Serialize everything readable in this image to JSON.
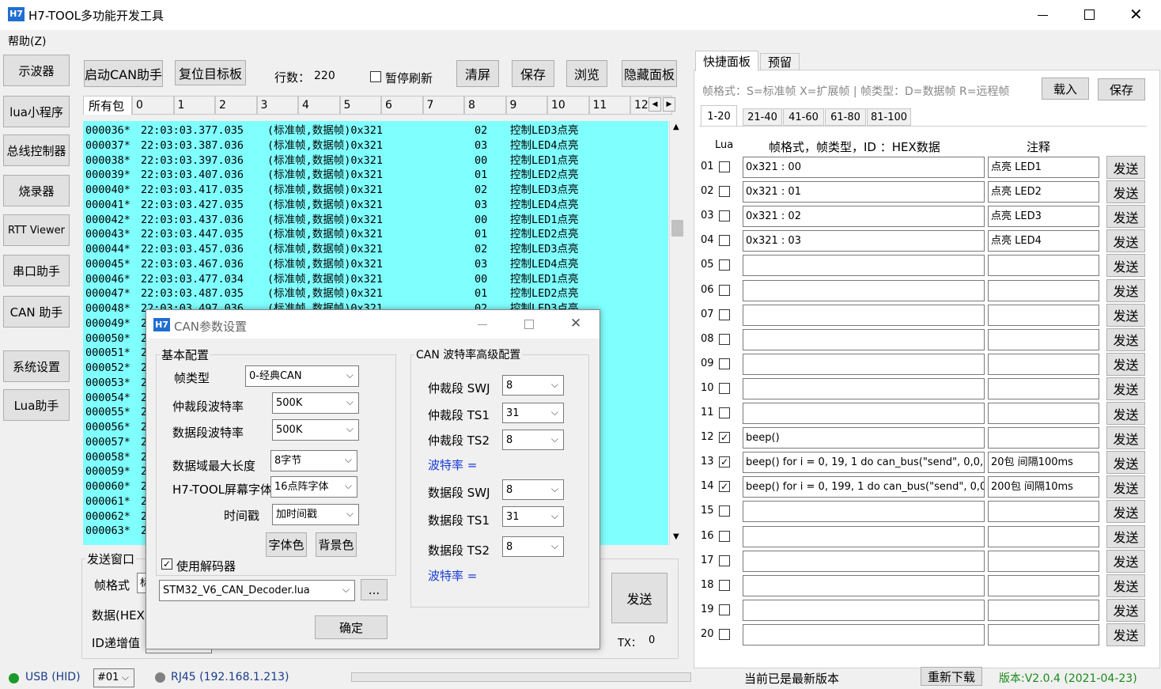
{
  "window": {
    "title": "H7-TOOL多功能开发工具",
    "logo": "H7",
    "min_icon": "minimize-icon",
    "max_icon": "maximize-icon",
    "close_icon": "close-icon"
  },
  "menu": {
    "help": "帮助(Z)"
  },
  "sidebar": {
    "items": [
      {
        "label": "示波器"
      },
      {
        "label": "lua小程序"
      },
      {
        "label": "总线控制器"
      },
      {
        "label": "烧录器"
      },
      {
        "label": "RTT Viewer"
      },
      {
        "label": "串口助手"
      },
      {
        "label": "CAN 助手"
      },
      {
        "label": "系统设置"
      },
      {
        "label": "Lua助手"
      }
    ]
  },
  "toolbar": {
    "start_can": "启动CAN助手",
    "reset_target": "复位目标板",
    "rows_label": "行数：",
    "rows_value": "220",
    "pause_refresh": "暂停刷新",
    "clear": "清屏",
    "save": "保存",
    "browse": "浏览",
    "hide_panel": "隐藏面板"
  },
  "packet_tabs": [
    "所有包",
    "0",
    "1",
    "2",
    "3",
    "4",
    "5",
    "6",
    "7",
    "8",
    "9",
    "10",
    "11",
    "12"
  ],
  "log": [
    {
      "idx": "000036*",
      "time": "22:03:03.377.035",
      "type": "(标准帧,数据帧)0x321",
      "data": "02",
      "note": "控制LED3点亮"
    },
    {
      "idx": "000037*",
      "time": "22:03:03.387.036",
      "type": "(标准帧,数据帧)0x321",
      "data": "03",
      "note": "控制LED4点亮"
    },
    {
      "idx": "000038*",
      "time": "22:03:03.397.036",
      "type": "(标准帧,数据帧)0x321",
      "data": "00",
      "note": "控制LED1点亮"
    },
    {
      "idx": "000039*",
      "time": "22:03:03.407.036",
      "type": "(标准帧,数据帧)0x321",
      "data": "01",
      "note": "控制LED2点亮"
    },
    {
      "idx": "000040*",
      "time": "22:03:03.417.035",
      "type": "(标准帧,数据帧)0x321",
      "data": "02",
      "note": "控制LED3点亮"
    },
    {
      "idx": "000041*",
      "time": "22:03:03.427.035",
      "type": "(标准帧,数据帧)0x321",
      "data": "03",
      "note": "控制LED4点亮"
    },
    {
      "idx": "000042*",
      "time": "22:03:03.437.036",
      "type": "(标准帧,数据帧)0x321",
      "data": "00",
      "note": "控制LED1点亮"
    },
    {
      "idx": "000043*",
      "time": "22:03:03.447.035",
      "type": "(标准帧,数据帧)0x321",
      "data": "01",
      "note": "控制LED2点亮"
    },
    {
      "idx": "000044*",
      "time": "22:03:03.457.036",
      "type": "(标准帧,数据帧)0x321",
      "data": "02",
      "note": "控制LED3点亮"
    },
    {
      "idx": "000045*",
      "time": "22:03:03.467.036",
      "type": "(标准帧,数据帧)0x321",
      "data": "03",
      "note": "控制LED4点亮"
    },
    {
      "idx": "000046*",
      "time": "22:03:03.477.034",
      "type": "(标准帧,数据帧)0x321",
      "data": "00",
      "note": "控制LED1点亮"
    },
    {
      "idx": "000047*",
      "time": "22:03:03.487.035",
      "type": "(标准帧,数据帧)0x321",
      "data": "01",
      "note": "控制LED2点亮"
    },
    {
      "idx": "000048*",
      "time": "22:03:03.497.036",
      "type": "(标准帧,数据帧)0x321",
      "data": "02",
      "note": "控制LED3点亮"
    },
    {
      "idx": "000049*",
      "time": "2",
      "type": "",
      "data": "",
      "note": ""
    },
    {
      "idx": "000050*",
      "time": "2",
      "type": "",
      "data": "",
      "note": ""
    },
    {
      "idx": "000051*",
      "time": "2",
      "type": "",
      "data": "",
      "note": ""
    },
    {
      "idx": "000052*",
      "time": "2",
      "type": "",
      "data": "",
      "note": ""
    },
    {
      "idx": "000053*",
      "time": "2",
      "type": "",
      "data": "",
      "note": ""
    },
    {
      "idx": "000054*",
      "time": "2",
      "type": "",
      "data": "",
      "note": ""
    },
    {
      "idx": "000055*",
      "time": "2",
      "type": "",
      "data": "",
      "note": ""
    },
    {
      "idx": "000056*",
      "time": "2",
      "type": "",
      "data": "",
      "note": ""
    },
    {
      "idx": "000057*",
      "time": "2",
      "type": "",
      "data": "",
      "note": ""
    },
    {
      "idx": "000058*",
      "time": "2",
      "type": "",
      "data": "",
      "note": ""
    },
    {
      "idx": "000059*",
      "time": "2",
      "type": "",
      "data": "",
      "note": ""
    },
    {
      "idx": "000060*",
      "time": "2",
      "type": "",
      "data": "",
      "note": ""
    },
    {
      "idx": "000061*",
      "time": "2",
      "type": "",
      "data": "",
      "note": ""
    },
    {
      "idx": "000062*",
      "time": "2",
      "type": "",
      "data": "",
      "note": ""
    },
    {
      "idx": "000063*",
      "time": "2",
      "type": "",
      "data": "",
      "note": ""
    }
  ],
  "send_window": {
    "title": "发送窗口",
    "frame_format": "帧格式",
    "frame_format_value": "标",
    "data_hex": "数据(HEX)",
    "id_increment": "ID递增值",
    "send": "发送",
    "tx_label": "TX：",
    "tx_value": "0"
  },
  "dialog": {
    "title": "CAN参数设置",
    "logo": "H7",
    "basic_group": "基本配置",
    "frame_type_label": "帧类型",
    "frame_type_value": "0-经典CAN",
    "arb_baud_label": "仲裁段波特率",
    "arb_baud_value": "500K",
    "data_baud_label": "数据段波特率",
    "data_baud_value": "500K",
    "max_len_label": "数据域最大长度",
    "max_len_value": "8字节",
    "font_label": "H7-TOOL屏幕字体",
    "font_value": "16点阵字体",
    "timestamp_label": "时间戳",
    "timestamp_value": "加时间戳",
    "font_color": "字体色",
    "bg_color": "背景色",
    "use_decoder": "使用解码器",
    "decoder_value": "STM32_V6_CAN_Decoder.lua",
    "browse": "...",
    "advanced_group": "CAN 波特率高级配置",
    "arb_swj_label": "仲裁段 SWJ",
    "arb_swj_value": "8",
    "arb_ts1_label": "仲裁段 TS1",
    "arb_ts1_value": "31",
    "arb_ts2_label": "仲裁段 TS2",
    "arb_ts2_value": "8",
    "arb_rate": "波特率 =",
    "data_swj_label": "数据段 SWJ",
    "data_swj_value": "8",
    "data_ts1_label": "数据段 TS1",
    "data_ts1_value": "31",
    "data_ts2_label": "数据段 TS2",
    "data_ts2_value": "8",
    "data_rate": "波特率 =",
    "ok": "确定",
    "link_color": "#1a3cd6"
  },
  "quick_panel": {
    "tabs": [
      "快捷面板",
      "预留"
    ],
    "hint": "帧格式：S=标准帧 X=扩展帧 | 帧类型：D=数据帧 R=远程帧",
    "load": "载入",
    "save": "保存",
    "page_tabs": [
      "1-20",
      "21-40",
      "41-60",
      "61-80",
      "81-100"
    ],
    "col_lua": "Lua",
    "col_cmd": "帧格式，帧类型，ID ：HEX数据",
    "col_note": "注释",
    "send_label": "发送",
    "rows": [
      {
        "no": "01",
        "checked": false,
        "cmd": "0x321 : 00",
        "note": "点亮 LED1"
      },
      {
        "no": "02",
        "checked": false,
        "cmd": "0x321 : 01",
        "note": "点亮 LED2"
      },
      {
        "no": "03",
        "checked": false,
        "cmd": "0x321 : 02",
        "note": "点亮 LED3"
      },
      {
        "no": "04",
        "checked": false,
        "cmd": "0x321 : 03",
        "note": "点亮 LED4"
      },
      {
        "no": "05",
        "checked": false,
        "cmd": "",
        "note": ""
      },
      {
        "no": "06",
        "checked": false,
        "cmd": "",
        "note": ""
      },
      {
        "no": "07",
        "checked": false,
        "cmd": "",
        "note": ""
      },
      {
        "no": "08",
        "checked": false,
        "cmd": "",
        "note": ""
      },
      {
        "no": "09",
        "checked": false,
        "cmd": "",
        "note": ""
      },
      {
        "no": "10",
        "checked": false,
        "cmd": "",
        "note": ""
      },
      {
        "no": "11",
        "checked": false,
        "cmd": "",
        "note": ""
      },
      {
        "no": "12",
        "checked": true,
        "cmd": "beep()",
        "note": ""
      },
      {
        "no": "13",
        "checked": true,
        "cmd": "beep() for i = 0, 19, 1 do can_bus(\"send\", 0,0, 0",
        "note": "20包 间隔100ms"
      },
      {
        "no": "14",
        "checked": true,
        "cmd": "beep() for i = 0, 199, 1 do can_bus(\"send\", 0,0,",
        "note": "200包 间隔10ms"
      },
      {
        "no": "15",
        "checked": false,
        "cmd": "",
        "note": ""
      },
      {
        "no": "16",
        "checked": false,
        "cmd": "",
        "note": ""
      },
      {
        "no": "17",
        "checked": false,
        "cmd": "",
        "note": ""
      },
      {
        "no": "18",
        "checked": false,
        "cmd": "",
        "note": ""
      },
      {
        "no": "19",
        "checked": false,
        "cmd": "",
        "note": ""
      },
      {
        "no": "20",
        "checked": false,
        "cmd": "",
        "note": ""
      }
    ]
  },
  "status": {
    "usb": "USB (HID)",
    "usb_color": "#1a9a2a",
    "device": "#01",
    "rj45": "RJ45 (192.168.1.213)",
    "rj45_color": "#808080",
    "update_msg": "当前已是最新版本",
    "redownload": "重新下载",
    "version": "版本:V2.0.4 (2021-04-23)",
    "version_color": "#1a8a1a"
  },
  "colors": {
    "log_bg": "#80ffff",
    "logo_bg": "#1f6fd1"
  }
}
